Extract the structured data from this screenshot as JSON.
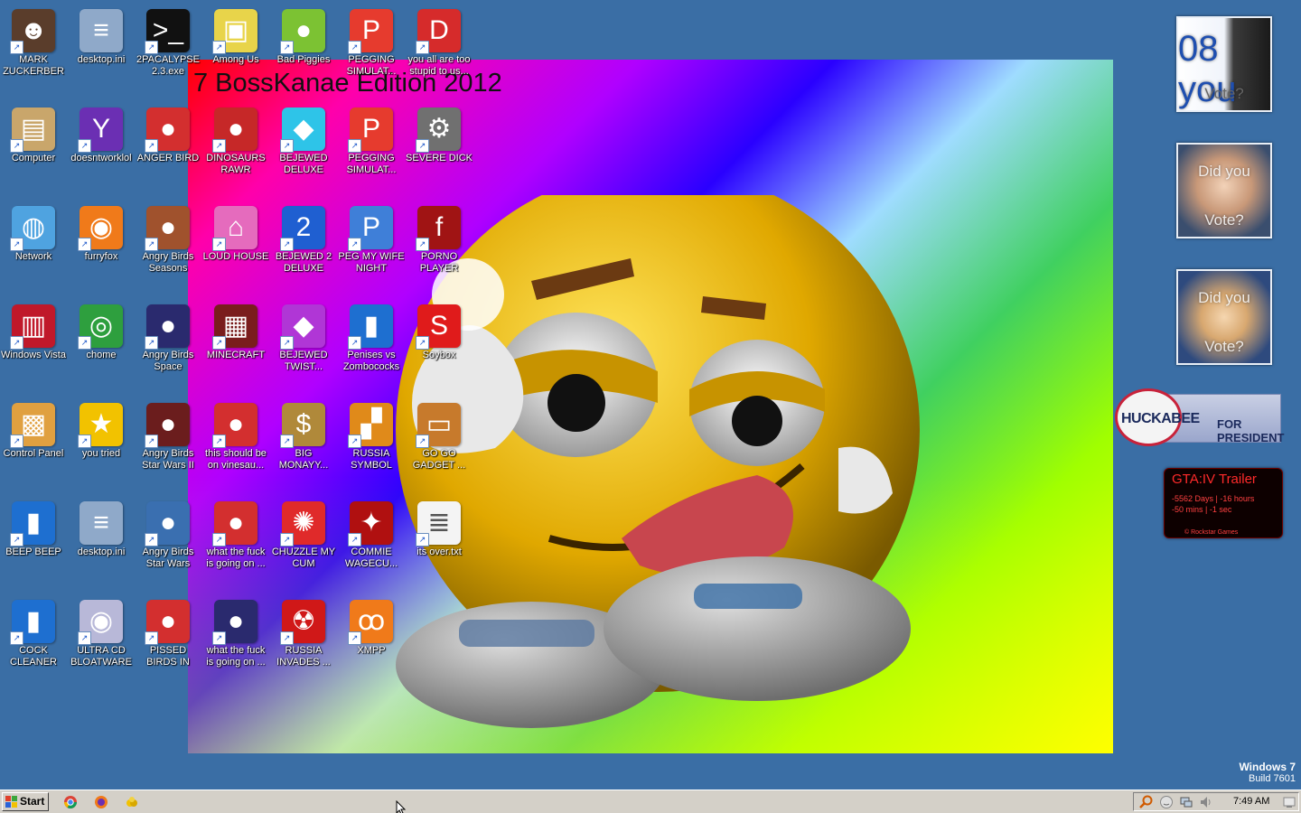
{
  "wallpaper": {
    "title": "7 BossKanae Edition 2012"
  },
  "desktop_icons": [
    {
      "label": "MARK ZUCKERBERG",
      "icon": "person-icon",
      "color": "#5a3d2b",
      "glyph": "☻"
    },
    {
      "label": "desktop.ini",
      "icon": "ini-file-icon",
      "color": "#8fa9c9",
      "glyph": "≡"
    },
    {
      "label": "2PACALYPSE 2.3.exe",
      "icon": "console-icon",
      "color": "#111111",
      "glyph": ">_"
    },
    {
      "label": "Among Us",
      "icon": "among-us-icon",
      "color": "#e8d44a",
      "glyph": "▣"
    },
    {
      "label": "Bad Piggies",
      "icon": "pig-icon",
      "color": "#7cc233",
      "glyph": "●"
    },
    {
      "label": "PEGGING SIMULAT...",
      "icon": "p-logo-icon",
      "color": "#e63b2e",
      "glyph": "P"
    },
    {
      "label": "you all are too stupid to us...",
      "icon": "dev-cpp-icon",
      "color": "#d62b2b",
      "glyph": "D"
    },
    {
      "label": "Computer",
      "icon": "computer-icon",
      "color": "#c9a66b",
      "glyph": "▤"
    },
    {
      "label": "doesntworklol",
      "icon": "yahoo-icon",
      "color": "#6b2fb3",
      "glyph": "Y"
    },
    {
      "label": "ANGER BIRD",
      "icon": "angry-bird-icon",
      "color": "#d32f2f",
      "glyph": "●"
    },
    {
      "label": "DINOSAURS RAWR",
      "icon": "angry-bird-icon",
      "color": "#c62828",
      "glyph": "●"
    },
    {
      "label": "BEJEWED DELUXE",
      "icon": "gem-icon",
      "color": "#2ec4e8",
      "glyph": "◆"
    },
    {
      "label": "PEGGING SIMULAT...",
      "icon": "p-logo-icon",
      "color": "#e63b2e",
      "glyph": "P"
    },
    {
      "label": "SEVERE DICK",
      "icon": "gear-icon",
      "color": "#707070",
      "glyph": "⚙"
    },
    {
      "label": "Network",
      "icon": "network-globe-icon",
      "color": "#4fa3e0",
      "glyph": "◍"
    },
    {
      "label": "furryfox",
      "icon": "firefox-icon",
      "color": "#f07a1a",
      "glyph": "◉"
    },
    {
      "label": "Angry Birds Seasons",
      "icon": "angry-bird-icon",
      "color": "#a0522d",
      "glyph": "●"
    },
    {
      "label": "LOUD HOUSE",
      "icon": "house-icon",
      "color": "#e56bbd",
      "glyph": "⌂"
    },
    {
      "label": "BEJEWED 2 DELUXE",
      "icon": "gem-icon",
      "color": "#1f5fd1",
      "glyph": "2"
    },
    {
      "label": "PEG MY WIFE NIGHT",
      "icon": "p-logo-icon",
      "color": "#3f7fd8",
      "glyph": "P"
    },
    {
      "label": "PORNO PLAYER",
      "icon": "flash-icon",
      "color": "#a01414",
      "glyph": "f"
    },
    {
      "label": "Windows Vista",
      "icon": "trash-bin-icon",
      "color": "#c0182a",
      "glyph": "▥"
    },
    {
      "label": "chome",
      "icon": "chrome-icon",
      "color": "#2e9f3e",
      "glyph": "◎"
    },
    {
      "label": "Angry Birds Space",
      "icon": "angry-bird-icon",
      "color": "#2a2a6e",
      "glyph": "●"
    },
    {
      "label": "MINECRAFT",
      "icon": "minecraft-icon",
      "color": "#7a1d1d",
      "glyph": "▦"
    },
    {
      "label": "BEJEWED TWIST...",
      "icon": "gem-icon",
      "color": "#b036d6",
      "glyph": "◆"
    },
    {
      "label": "Penises vs Zombococks",
      "icon": "book-icon",
      "color": "#1e6fd0",
      "glyph": "▮"
    },
    {
      "label": "Soybox",
      "icon": "s-logo-icon",
      "color": "#e01b1b",
      "glyph": "S"
    },
    {
      "label": "Control Panel",
      "icon": "control-panel-icon",
      "color": "#e0a040",
      "glyph": "▩"
    },
    {
      "label": "you tried",
      "icon": "star-icon",
      "color": "#f2c200",
      "glyph": "★"
    },
    {
      "label": "Angry Birds Star Wars II",
      "icon": "angry-bird-icon",
      "color": "#6b1d1d",
      "glyph": "●"
    },
    {
      "label": "this should be on vinesau...",
      "icon": "angry-bird-icon",
      "color": "#d32f2f",
      "glyph": "●"
    },
    {
      "label": "BIG MONAYY...",
      "icon": "money-bag-icon",
      "color": "#b0893a",
      "glyph": "$"
    },
    {
      "label": "RUSSIA SYMBOL",
      "icon": "hammer-icon",
      "color": "#e08a1a",
      "glyph": "▞"
    },
    {
      "label": "GO GO GADGET ...",
      "icon": "briefcase-icon",
      "color": "#c77a2c",
      "glyph": "▭"
    },
    {
      "label": "BEEP BEEP",
      "icon": "book-icon",
      "color": "#1e6fd0",
      "glyph": "▮"
    },
    {
      "label": "desktop.ini",
      "icon": "ini-file-icon",
      "color": "#8fa9c9",
      "glyph": "≡"
    },
    {
      "label": "Angry Birds Star Wars",
      "icon": "angry-bird-icon",
      "color": "#3a6fb0",
      "glyph": "●"
    },
    {
      "label": "what the fuck is going on ...",
      "icon": "angry-bird-icon",
      "color": "#d32f2f",
      "glyph": "●"
    },
    {
      "label": "CHUZZLE MY CUM",
      "icon": "chuzzle-icon",
      "color": "#e02a2a",
      "glyph": "✺"
    },
    {
      "label": "COMMIE WAGECU...",
      "icon": "emblem-icon",
      "color": "#b01010",
      "glyph": "✦"
    },
    {
      "label": "its over.txt",
      "icon": "text-file-icon",
      "color": "#f4f4f4",
      "glyph": "≣"
    },
    {
      "label": "COCK CLEANER",
      "icon": "book-icon",
      "color": "#1e6fd0",
      "glyph": "▮"
    },
    {
      "label": "ULTRA CD BLOATWARE",
      "icon": "cd-icon",
      "color": "#b8b8d8",
      "glyph": "◉"
    },
    {
      "label": "PISSED BIRDS IN VIDEO G...",
      "icon": "angry-bird-icon",
      "color": "#d32f2f",
      "glyph": "●"
    },
    {
      "label": "what the fuck is going on ...",
      "icon": "angry-bird-icon",
      "color": "#2a2a6e",
      "glyph": "●"
    },
    {
      "label": "RUSSIA INVADES ...",
      "icon": "radiation-icon",
      "color": "#d01818",
      "glyph": "☢"
    },
    {
      "label": "XMPP",
      "icon": "xampp-icon",
      "color": "#f07a1a",
      "glyph": "ꝏ"
    }
  ],
  "gadgets": {
    "obama": {
      "line1": "08 you",
      "line2": "Vote?"
    },
    "mccain": {
      "line1": "Did you",
      "line2": "Vote?"
    },
    "clinton": {
      "line1": "Did you",
      "line2": "Vote?"
    },
    "huckabee": {
      "name": "HUCKABEE",
      "tagline": "FOR PRESIDENT"
    },
    "gta": {
      "title": "GTA:IV Trailer",
      "count_line1": "-5562 Days | -16 hours",
      "count_line2": "-50 mins | -1 sec",
      "footer": "© Rockstar Games"
    }
  },
  "watermark": {
    "os": "Windows 7",
    "build": "Build 7601"
  },
  "taskbar": {
    "start_label": "Start",
    "clock": "7:49 AM"
  },
  "colors": {
    "desktop": "#3a6ea5",
    "taskbar": "#d4d0c8"
  }
}
